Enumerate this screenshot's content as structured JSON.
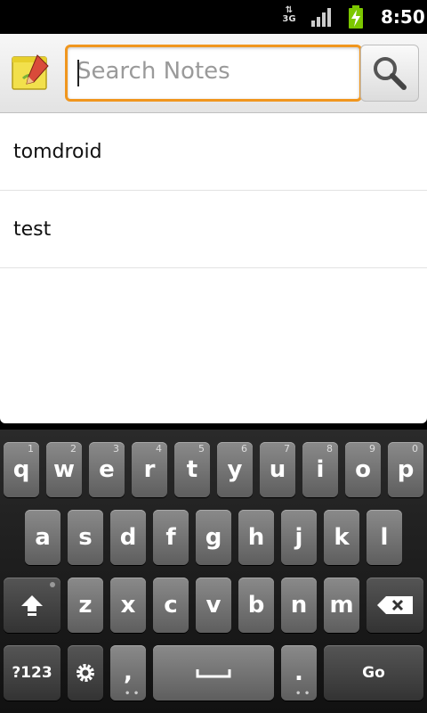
{
  "status": {
    "network": "3G",
    "time": "8:50",
    "battery_color": "#7cc700"
  },
  "search": {
    "placeholder": "Search Notes",
    "value": ""
  },
  "notes": [
    {
      "title": "tomdroid"
    },
    {
      "title": "test"
    }
  ],
  "keyboard": {
    "row1": [
      {
        "label": "q",
        "hint": "1"
      },
      {
        "label": "w",
        "hint": "2"
      },
      {
        "label": "e",
        "hint": "3"
      },
      {
        "label": "r",
        "hint": "4"
      },
      {
        "label": "t",
        "hint": "5"
      },
      {
        "label": "y",
        "hint": "6"
      },
      {
        "label": "u",
        "hint": "7"
      },
      {
        "label": "i",
        "hint": "8"
      },
      {
        "label": "o",
        "hint": "9"
      },
      {
        "label": "p",
        "hint": "0"
      }
    ],
    "row2": [
      "a",
      "s",
      "d",
      "f",
      "g",
      "h",
      "j",
      "k",
      "l"
    ],
    "row3": [
      "z",
      "x",
      "c",
      "v",
      "b",
      "n",
      "m"
    ],
    "symbols_label": "?123",
    "comma_label": ",",
    "period_label": ".",
    "go_label": "Go"
  },
  "accent_color": "#f0961e"
}
